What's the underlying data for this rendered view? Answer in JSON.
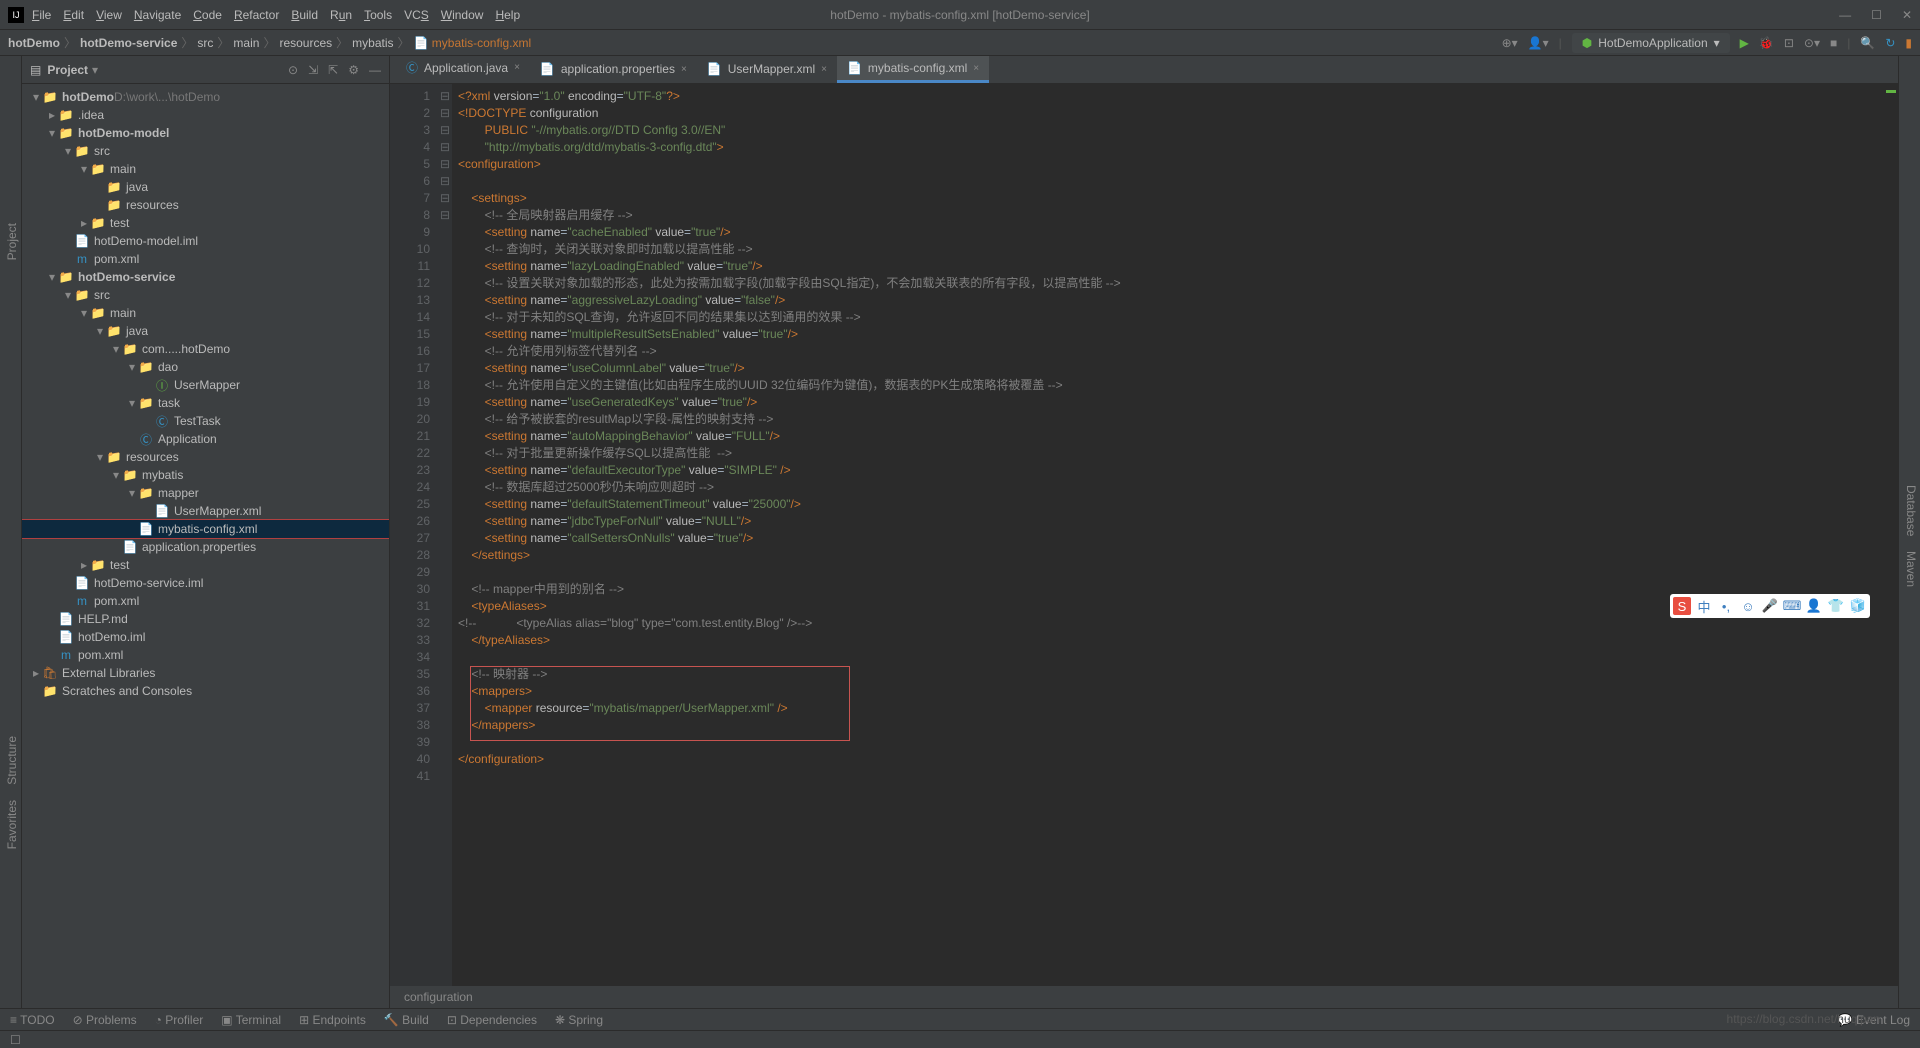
{
  "window": {
    "title": "hotDemo - mybatis-config.xml [hotDemo-service]"
  },
  "menu": [
    "File",
    "Edit",
    "View",
    "Navigate",
    "Code",
    "Refactor",
    "Build",
    "Run",
    "Tools",
    "VCS",
    "Window",
    "Help"
  ],
  "nav": {
    "crumbs": [
      "hotDemo",
      "hotDemo-service",
      "src",
      "main",
      "resources",
      "mybatis",
      "mybatis-config.xml"
    ],
    "runConfig": "HotDemoApplication"
  },
  "projectPanel": {
    "title": "Project"
  },
  "tree": [
    {
      "l": 0,
      "arrow": "▾",
      "icon": "📁",
      "text": "hotDemo",
      "suffix": "  D:\\work\\...\\hotDemo",
      "bold": true
    },
    {
      "l": 1,
      "arrow": "▸",
      "icon": "📁",
      "text": ".idea"
    },
    {
      "l": 1,
      "arrow": "▾",
      "icon": "📁",
      "text": "hotDemo-model",
      "bold": true
    },
    {
      "l": 2,
      "arrow": "▾",
      "icon": "📁",
      "text": "src"
    },
    {
      "l": 3,
      "arrow": "▾",
      "icon": "📁",
      "text": "main"
    },
    {
      "l": 4,
      "arrow": "",
      "icon": "📁",
      "text": "java",
      "blue": true
    },
    {
      "l": 4,
      "arrow": "",
      "icon": "📁",
      "text": "resources"
    },
    {
      "l": 3,
      "arrow": "▸",
      "icon": "📁",
      "text": "test"
    },
    {
      "l": 2,
      "arrow": "",
      "icon": "📄",
      "text": "hotDemo-model.iml"
    },
    {
      "l": 2,
      "arrow": "",
      "icon": "m",
      "text": "pom.xml"
    },
    {
      "l": 1,
      "arrow": "▾",
      "icon": "📁",
      "text": "hotDemo-service",
      "bold": true
    },
    {
      "l": 2,
      "arrow": "▾",
      "icon": "📁",
      "text": "src"
    },
    {
      "l": 3,
      "arrow": "▾",
      "icon": "📁",
      "text": "main"
    },
    {
      "l": 4,
      "arrow": "▾",
      "icon": "📁",
      "text": "java",
      "blue": true
    },
    {
      "l": 5,
      "arrow": "▾",
      "icon": "📁",
      "text": "com.....hotDemo"
    },
    {
      "l": 6,
      "arrow": "▾",
      "icon": "📁",
      "text": "dao"
    },
    {
      "l": 7,
      "arrow": "",
      "icon": "Ⓘ",
      "text": "UserMapper",
      "green": true
    },
    {
      "l": 6,
      "arrow": "▾",
      "icon": "📁",
      "text": "task"
    },
    {
      "l": 7,
      "arrow": "",
      "icon": "Ⓒ",
      "text": "TestTask"
    },
    {
      "l": 6,
      "arrow": "",
      "icon": "Ⓒ",
      "text": "Application",
      "green": true
    },
    {
      "l": 4,
      "arrow": "▾",
      "icon": "📁",
      "text": "resources"
    },
    {
      "l": 5,
      "arrow": "▾",
      "icon": "📁",
      "text": "mybatis"
    },
    {
      "l": 6,
      "arrow": "▾",
      "icon": "📁",
      "text": "mapper"
    },
    {
      "l": 7,
      "arrow": "",
      "icon": "📄",
      "text": "UserMapper.xml"
    },
    {
      "l": 6,
      "arrow": "",
      "icon": "📄",
      "text": "mybatis-config.xml",
      "selected": true
    },
    {
      "l": 5,
      "arrow": "",
      "icon": "📄",
      "text": "application.properties"
    },
    {
      "l": 3,
      "arrow": "▸",
      "icon": "📁",
      "text": "test"
    },
    {
      "l": 2,
      "arrow": "",
      "icon": "📄",
      "text": "hotDemo-service.iml"
    },
    {
      "l": 2,
      "arrow": "",
      "icon": "m",
      "text": "pom.xml"
    },
    {
      "l": 1,
      "arrow": "",
      "icon": "📄",
      "text": "HELP.md"
    },
    {
      "l": 1,
      "arrow": "",
      "icon": "📄",
      "text": "hotDemo.iml"
    },
    {
      "l": 1,
      "arrow": "",
      "icon": "m",
      "text": "pom.xml"
    },
    {
      "l": 0,
      "arrow": "▸",
      "icon": "🛍",
      "text": "External Libraries"
    },
    {
      "l": 0,
      "arrow": "",
      "icon": "📁",
      "text": "Scratches and Consoles"
    }
  ],
  "tabs": [
    {
      "label": "Application.java",
      "icon": "Ⓒ"
    },
    {
      "label": "application.properties",
      "icon": "📄"
    },
    {
      "label": "UserMapper.xml",
      "icon": "📄"
    },
    {
      "label": "mybatis-config.xml",
      "icon": "📄",
      "active": true
    }
  ],
  "code": {
    "lines": [
      "1",
      "2",
      "3",
      "4",
      "5",
      "6",
      "7",
      "8",
      "9",
      "10",
      "11",
      "12",
      "13",
      "14",
      "15",
      "16",
      "17",
      "18",
      "19",
      "20",
      "21",
      "22",
      "23",
      "24",
      "25",
      "26",
      "27",
      "28",
      "29",
      "30",
      "31",
      "32",
      "33",
      "34",
      "35",
      "36",
      "37",
      "38",
      "39",
      "40",
      "41"
    ],
    "l1": "<?xml version=\"1.0\" encoding=\"UTF-8\"?>",
    "l2": "<!DOCTYPE configuration",
    "l3": "        PUBLIC \"-//mybatis.org//DTD Config 3.0//EN\"",
    "l4": "        \"http://mybatis.org/dtd/mybatis-3-config.dtd\">",
    "l5": "<configuration>",
    "l7": "    <settings>",
    "l8": "        <!-- 全局映射器启用缓存 -->",
    "l9": "        <setting name=\"cacheEnabled\" value=\"true\"/>",
    "l10": "        <!-- 查询时，关闭关联对象即时加载以提高性能 -->",
    "l11": "        <setting name=\"lazyLoadingEnabled\" value=\"true\"/>",
    "l12": "        <!-- 设置关联对象加载的形态，此处为按需加载字段(加载字段由SQL指定)，不会加载关联表的所有字段，以提高性能 -->",
    "l13": "        <setting name=\"aggressiveLazyLoading\" value=\"false\"/>",
    "l14": "        <!-- 对于未知的SQL查询，允许返回不同的结果集以达到通用的效果 -->",
    "l15": "        <setting name=\"multipleResultSetsEnabled\" value=\"true\"/>",
    "l16": "        <!-- 允许使用列标签代替列名 -->",
    "l17": "        <setting name=\"useColumnLabel\" value=\"true\"/>",
    "l18": "        <!-- 允许使用自定义的主键值(比如由程序生成的UUID 32位编码作为键值)，数据表的PK生成策略将被覆盖 -->",
    "l19": "        <setting name=\"useGeneratedKeys\" value=\"true\"/>",
    "l20": "        <!-- 给予被嵌套的resultMap以字段-属性的映射支持 -->",
    "l21": "        <setting name=\"autoMappingBehavior\" value=\"FULL\"/>",
    "l22": "        <!-- 对于批量更新操作缓存SQL以提高性能  -->",
    "l23": "        <setting name=\"defaultExecutorType\" value=\"SIMPLE\" />",
    "l24": "        <!-- 数据库超过25000秒仍未响应则超时 -->",
    "l25": "        <setting name=\"defaultStatementTimeout\" value=\"25000\"/>",
    "l26": "        <setting name=\"jdbcTypeForNull\" value=\"NULL\"/>",
    "l27": "        <setting name=\"callSettersOnNulls\" value=\"true\"/>",
    "l28": "    </settings>",
    "l30": "    <!-- mapper中用到的别名 -->",
    "l31": "    <typeAliases>",
    "l32": "<!--            <typeAlias alias=\"blog\" type=\"com.test.entity.Blog\" />-->",
    "l33": "    </typeAliases>",
    "l35": "    <!-- 映射器 -->",
    "l36": "    <mappers>",
    "l37": "        <mapper resource=\"mybatis/mapper/UserMapper.xml\" />",
    "l38": "    </mappers>",
    "l40": "</configuration>"
  },
  "bottomCrumb": "configuration",
  "bottomBar": [
    "TODO",
    "Problems",
    "Profiler",
    "Terminal",
    "Endpoints",
    "Build",
    "Dependencies",
    "Spring"
  ],
  "eventLog": "Event Log",
  "leftGutter": [
    "Project",
    "Structure",
    "Favorites"
  ],
  "rightGutter": [
    "Database",
    "Maven"
  ],
  "watermark": "https://blog.csdn.net/huqipan"
}
